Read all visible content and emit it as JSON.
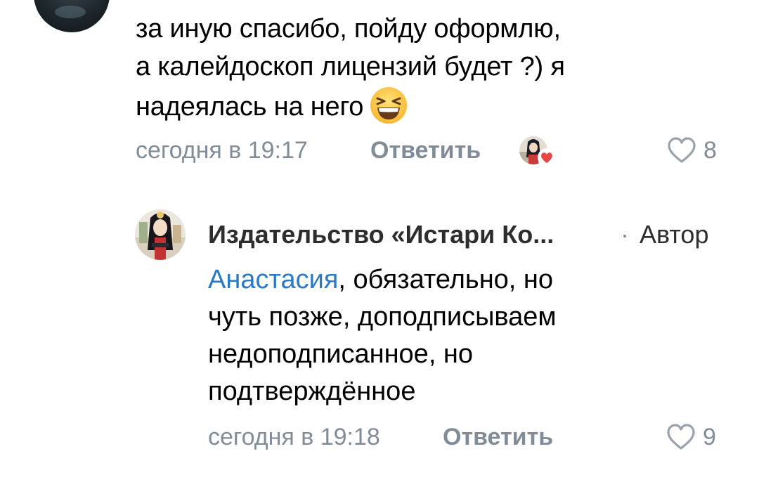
{
  "comment1": {
    "avatar_icon": "user-avatar-dark",
    "lines": [
      "за иную спасибо, пойду оформлю,",
      "а калейдоскоп лицензий будет ?) я",
      "надеялась на него"
    ],
    "emoji": "grinning-squinting-face-emoji",
    "time": "сегодня в 19:17",
    "reply_label": "Ответить",
    "author_liked_icon": "author-avatar-with-heart",
    "like_icon": "heart-outline-icon",
    "like_count": "8"
  },
  "comment2": {
    "author_name": "Издательство «Истари Ко...",
    "author_separator": "·",
    "author_badge": "Автор",
    "mention": "Анастасия",
    "line1_rest": ", обязательно, но",
    "lines": [
      "чуть позже, доподписываем",
      "недоподписанное, но",
      "подтверждённое"
    ],
    "time": "сегодня в 19:18",
    "reply_label": "Ответить",
    "like_icon": "heart-outline-icon",
    "like_count": "9"
  },
  "colors": {
    "meta_text": "#818c99",
    "mention": "#2a79c7",
    "heart_badge": "#e64646",
    "author_text": "#2c2d2e"
  }
}
